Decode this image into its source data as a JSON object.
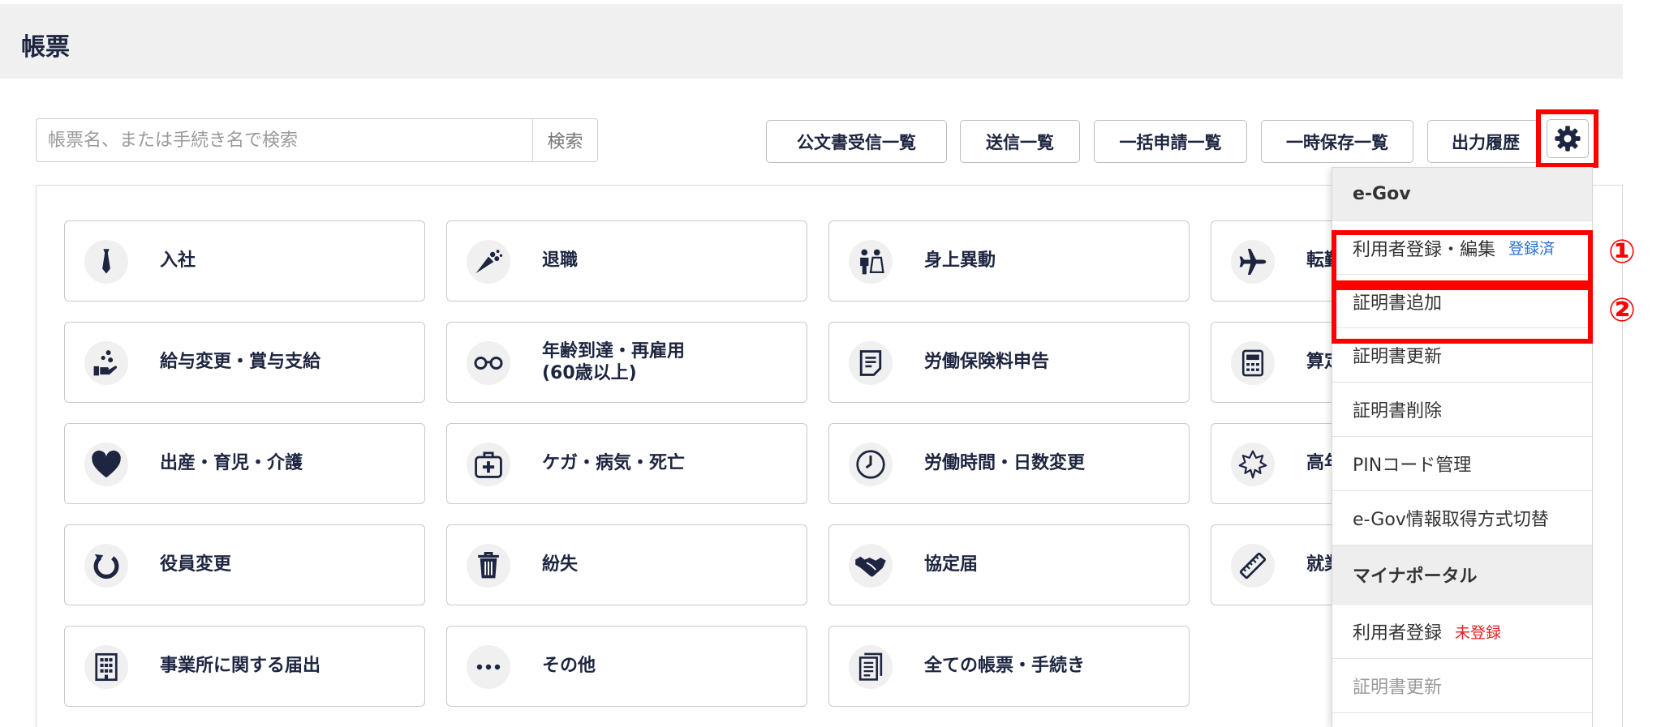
{
  "header": {
    "title": "帳票"
  },
  "search": {
    "placeholder": "帳票名、または手続き名で検索",
    "button": "検索"
  },
  "toolbar": {
    "buttons": [
      "公文書受信一覧",
      "送信一覧",
      "一括申請一覧",
      "一時保存一覧",
      "出力履歴"
    ],
    "settings_icon": "gear-icon"
  },
  "cards": [
    {
      "label": "入社",
      "icon": "necktie-icon"
    },
    {
      "label": "退職",
      "icon": "bouquet-icon"
    },
    {
      "label": "身上異動",
      "icon": "wedding-couple-icon"
    },
    {
      "label": "転勤",
      "icon": "airplane-icon"
    },
    {
      "label": "給与変更・賞与支給",
      "icon": "coins-hand-icon"
    },
    {
      "label": "年齢到達・再雇用\n(60歳以上)",
      "icon": "glasses-icon"
    },
    {
      "label": "労働保険料申告",
      "icon": "document-icon"
    },
    {
      "label": "算定",
      "icon": "calculator-icon"
    },
    {
      "label": "出産・育児・介護",
      "icon": "heart-icon"
    },
    {
      "label": "ケガ・病気・死亡",
      "icon": "first-aid-kit-icon"
    },
    {
      "label": "労働時間・日数変更",
      "icon": "clock-icon"
    },
    {
      "label": "高年",
      "icon": "maple-leaf-icon"
    },
    {
      "label": "役員変更",
      "icon": "refresh-icon"
    },
    {
      "label": "紛失",
      "icon": "trash-icon"
    },
    {
      "label": "協定届",
      "icon": "handshake-icon"
    },
    {
      "label": "就業",
      "icon": "ruler-icon"
    },
    {
      "label": "事業所に関する届出",
      "icon": "building-icon"
    },
    {
      "label": "その他",
      "icon": "more-dots-icon"
    },
    {
      "label": "全ての帳票・手続き",
      "icon": "documents-icon"
    }
  ],
  "settings_menu": {
    "egov_header": "e-Gov",
    "egov_user_registration": {
      "label": "利用者登録・編集",
      "status": "登録済"
    },
    "add_certificate": "証明書追加",
    "update_certificate": "証明書更新",
    "delete_certificate": "証明書削除",
    "pin_management": "PINコード管理",
    "egov_info_switch": "e-Gov情報取得方式切替",
    "myna_header": "マイナポータル",
    "myna_user_registration": {
      "label": "利用者登録",
      "status": "未登録"
    },
    "myna_update_certificate": "証明書更新"
  },
  "annotations": {
    "marker_1": "①",
    "marker_2": "②"
  },
  "colors": {
    "brand_navy": "#1d2540",
    "highlight_red": "#ff0000",
    "registered_blue": "#2a6ecf",
    "unregistered_red": "#e02020"
  }
}
